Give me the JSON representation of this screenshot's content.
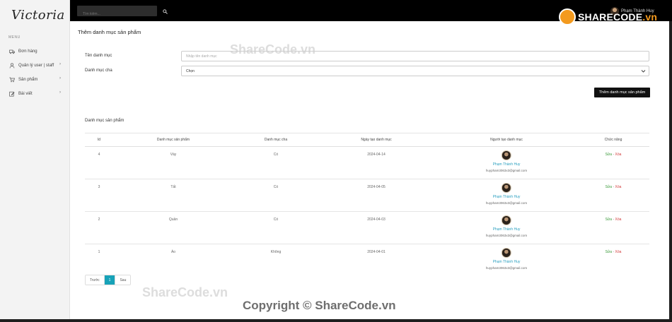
{
  "app": {
    "logo": "Victoria"
  },
  "sidebar": {
    "menu_heading": "MENU",
    "items": [
      {
        "label": "Đơn hàng",
        "icon": "truck-icon",
        "has_chevron": false
      },
      {
        "label": "Quản lý user | staff",
        "icon": "user-icon",
        "has_chevron": true
      },
      {
        "label": "Sản phẩm",
        "icon": "cart-icon",
        "has_chevron": true
      },
      {
        "label": "Bài viết",
        "icon": "edit-icon",
        "has_chevron": true
      }
    ]
  },
  "topbar": {
    "search_placeholder": "Tìm kiếm...",
    "user_name": "Phạm Thành Huy"
  },
  "form": {
    "title": "Thêm danh mục sản phẩm",
    "name_label": "Tên danh mục",
    "name_placeholder": "Nhập tên danh mục",
    "parent_label": "Danh mục cha",
    "parent_value": "Chọn",
    "submit_label": "Thêm danh mục sản phẩm"
  },
  "table": {
    "section_title": "Danh mục sản phẩm",
    "headers": [
      "Id",
      "Danh mục sản phẩm",
      "Danh mục cha",
      "Ngày tạo danh mục",
      "Người tạo danh mục",
      "Chức năng"
    ],
    "rows": [
      {
        "id": "4",
        "name": "Váy",
        "parent": "Có",
        "created": "2024-04-14",
        "creator": "Phạm Thành Huy",
        "email": "huypham3063x3@gmail.com"
      },
      {
        "id": "3",
        "name": "Tất",
        "parent": "Có",
        "created": "2024-04-05",
        "creator": "Phạm Thành Huy",
        "email": "huypham3063x3@gmail.com"
      },
      {
        "id": "2",
        "name": "Quần",
        "parent": "Có",
        "created": "2024-04-03",
        "creator": "Phạm Thành Huy",
        "email": "huypham3063x3@gmail.com"
      },
      {
        "id": "1",
        "name": "Áo",
        "parent": "Không",
        "created": "2024-04-01",
        "creator": "Phạm Thành Huy",
        "email": "huypham3063x3@gmail.com"
      }
    ],
    "action_edit": "Sửa",
    "action_sep": " - ",
    "action_delete": "Xóa"
  },
  "pagination": {
    "prev": "Trước",
    "current": "1",
    "next": "Sau"
  },
  "watermarks": {
    "logo_main": "SHARECODE",
    "logo_suffix": ".vn",
    "center": "ShareCode.vn",
    "lower": "ShareCode.vn",
    "copyright": "Copyright © ShareCode.vn"
  },
  "colors": {
    "accent": "#17a2b8",
    "edit": "#3a9a3a",
    "delete": "#d23a3a",
    "creator_link": "#2a9fbf"
  }
}
